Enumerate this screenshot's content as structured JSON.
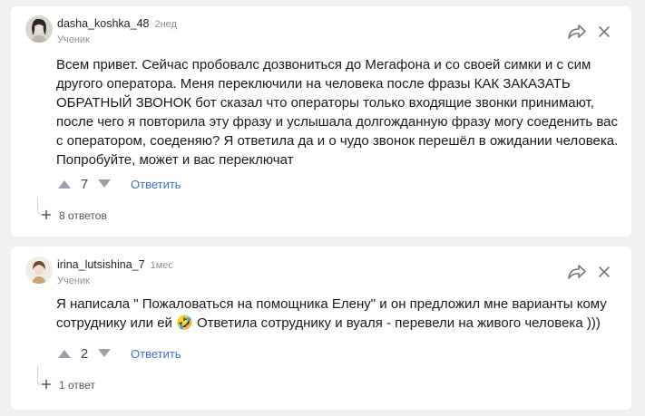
{
  "comments": [
    {
      "username": "dasha_koshka_48",
      "time": "2нед",
      "role": "Ученик",
      "text": "Всем привет. Сейчас пробовалс дозвониться до Мегафона и со своей симки и с сим другого оператора. Меня переключили на человека после фразы КАК ЗАКАЗАТЬ ОБРАТНЫЙ ЗВОНОК бот сказал что операторы только входящие звонки принимают, после чего я повторила эту фразу и услышала долгожданную фразу могу соеденить вас с оператором, соеденяю? Я ответила да и о чудо звонок перешёл в ожидании человека. Попробуйте, может и вас переключат",
      "votes": "7",
      "reply_label": "Ответить",
      "replies_label": "8 ответов"
    },
    {
      "username": "irina_lutsishina_7",
      "time": "1мес",
      "role": "Ученик",
      "text_before_emoji": "Я написала \" Пожаловаться на помощника Елену\" и он предложил мне варианты кому сотруднику или ей ",
      "emoji": "🤣",
      "text_after_emoji": " Ответила сотруднику и вуаля - перевели на живого человека )))",
      "votes": "2",
      "reply_label": "Ответить",
      "replies_label": "1 ответ"
    }
  ],
  "colors": {
    "background": "#f0f0f0",
    "card": "#ffffff",
    "link": "#3b6fd9",
    "muted": "#8a8f99"
  },
  "icons": [
    "avatar",
    "share-icon",
    "more-icon",
    "upvote-icon",
    "downvote-icon",
    "expand-icon"
  ]
}
